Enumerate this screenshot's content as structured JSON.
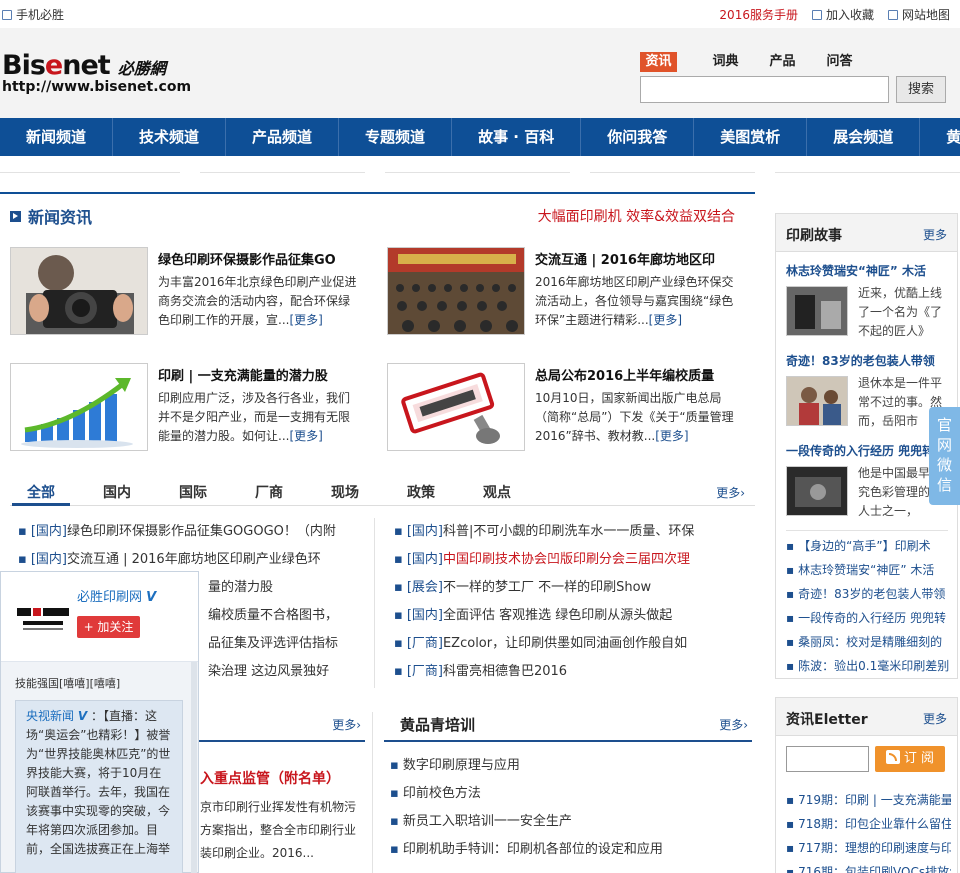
{
  "topbar": {
    "mobile": "手机必胜",
    "manual": "2016服务手册",
    "favorite": "加入收藏",
    "sitemap": "网站地图"
  },
  "logo": {
    "brand_a": "Bis",
    "brand_b": "e",
    "brand_c": "net",
    "cn": "必勝網",
    "url": "http://www.bisenet.com"
  },
  "search": {
    "tabs": [
      "资讯",
      "词典",
      "产品",
      "问答"
    ],
    "button": "搜索"
  },
  "nav": [
    "新闻频道",
    "技术频道",
    "产品频道",
    "专题频道",
    "故事 · 百科",
    "你问我答",
    "美图赏析",
    "展会频道",
    "黄品青"
  ],
  "news": {
    "title": "新闻资讯",
    "ad": "大幅面印刷机 效率&效益双结合",
    "more_label": "[更多]",
    "cards": [
      {
        "title": "绿色印刷环保摄影作品征集GO",
        "text": "为丰富2016年北京绿色印刷产业促进商务交流会的活动内容，配合环保绿色印刷工作的开展，宣..."
      },
      {
        "title": "交流互通 | 2016年廊坊地区印",
        "text": "2016年廊坊地区印刷产业绿色环保交流活动上，各位领导与嘉宾围绕“绿色环保”主题进行精彩..."
      },
      {
        "title": "印刷 | 一支充满能量的潜力股",
        "text": "印刷应用广泛，涉及各行各业，我们并不是夕阳产业，而是一支拥有无限能量的潜力股。如何让..."
      },
      {
        "title": "总局公布2016上半年编校质量",
        "text": "10月10日，国家新闻出版广电总局（简称“总局”）下发《关于“质量管理2016”辞书、教材教..."
      }
    ]
  },
  "tabs": {
    "items": [
      "全部",
      "国内",
      "国际",
      "厂商",
      "现场",
      "政策",
      "观点"
    ],
    "more": "更多›"
  },
  "list_left": [
    {
      "cat": "[国内]",
      "text": "绿色印刷环保摄影作品征集GOGOGO！（内附"
    },
    {
      "cat": "[国内]",
      "text": "交流互通 | 2016年廊坊地区印刷产业绿色环"
    },
    {
      "cat": "",
      "text": "量的潜力股"
    },
    {
      "cat": "",
      "text": "编校质量不合格图书，"
    },
    {
      "cat": "",
      "text": "品征集及评选评估指标"
    },
    {
      "cat": "",
      "text": "染治理 这边风景独好"
    }
  ],
  "list_right": [
    {
      "cat": "[国内]",
      "text": "科普|不可小觑的印刷洗车水一一质量、环保",
      "red": false
    },
    {
      "cat": "[国内]",
      "text": "中国印刷技术协会凹版印刷分会三届四次理",
      "red": true
    },
    {
      "cat": "[展会]",
      "text": "不一样的梦工厂 不一样的印刷Show",
      "red": false
    },
    {
      "cat": "[国内]",
      "text": "全面评估 客观推选 绿色印刷从源头做起",
      "red": false
    },
    {
      "cat": "[厂商]",
      "text": "EZcolor，让印刷供墨如同油画创作般自如",
      "red": false
    },
    {
      "cat": "[厂商]",
      "text": "科雷亮相德鲁巴2016",
      "red": false
    }
  ],
  "section_left": {
    "more": "更多›",
    "headline": "入重点监管（附名单）",
    "text": "京市印刷行业挥发性有机物污方案指出，整合全市印刷行业装印刷企业。2016..."
  },
  "section_train": {
    "title": "黄品青培训",
    "more": "更多›",
    "items": [
      "数字印刷原理与应用",
      "印前校色方法",
      "新员工入职培训一一安全生产",
      "印刷机助手特训：印刷机各部位的设定和应用"
    ]
  },
  "right_story": {
    "title": "印刷故事",
    "more": "更多",
    "stories": [
      {
        "title": "林志玲赞瑞安“神匠” 木活",
        "text": "近来，优酷上线了一个名为《了不起的匠人》"
      },
      {
        "title": "奇迹！83岁的老包装人带领",
        "text": "退休本是一件平常不过的事。然而，岳阳市"
      },
      {
        "title": "一段传奇的入行经历 兜兜转",
        "text": "他是中国最早研究色彩管理的业人士之一，"
      }
    ],
    "list": [
      "【身边的“高手”】印刷术",
      "林志玲赞瑞安“神匠” 木活",
      "奇迹！83岁的老包装人带领",
      "一段传奇的入行经历 兜兜转",
      "桑丽凤：校对是精雕细刻的",
      "陈波：验出0.1毫米印刷差别"
    ]
  },
  "right_eletter": {
    "title": "资讯Eletter",
    "more": "更多",
    "subscribe": "订 阅",
    "items": [
      "719期：印刷 | 一支充满能量",
      "718期：印包企业靠什么留住",
      "717期：理想的印刷速度与印",
      "716期：包装印刷VOCs排放怎"
    ]
  },
  "weibo": {
    "name": "必胜印刷网",
    "follow": "+ 加关注",
    "tag": "技能强国[嘻嘻][嘻嘻]",
    "source": "央视新闻",
    "post": "：【直播：这场“奥运会”也精彩！】被誉为“世界技能奥林匹克”的世界技能大赛，将于10月在阿联酋举行。去年，我国在该赛事中实现零的突破，今年将第四次派团参加。目前，全国选拔赛正在上海举"
  },
  "sidetab": "官网微信",
  "colors": {
    "nav": "#0e4f96",
    "accent": "#c8161d",
    "link": "#1d4f8e"
  }
}
